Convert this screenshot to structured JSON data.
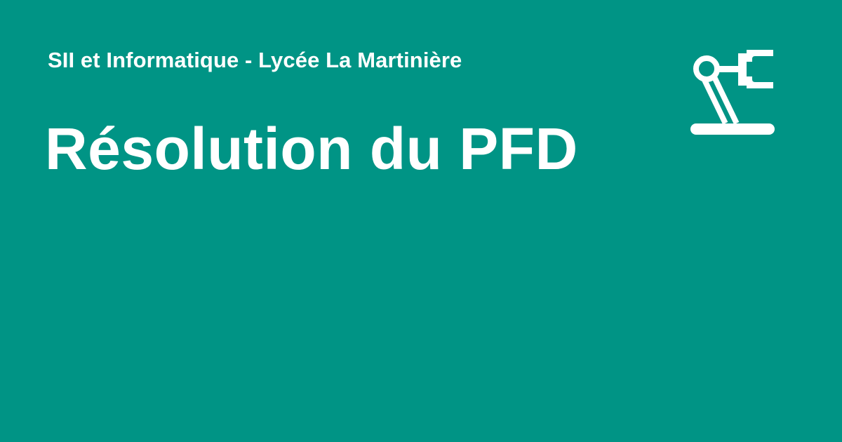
{
  "site": {
    "name": "SII et Informatique - Lycée La Martinière"
  },
  "page": {
    "title": "Résolution du PFD"
  },
  "logo": {
    "icon": "robot-arm-icon"
  },
  "colors": {
    "background": "#009485",
    "foreground": "#ffffff"
  }
}
